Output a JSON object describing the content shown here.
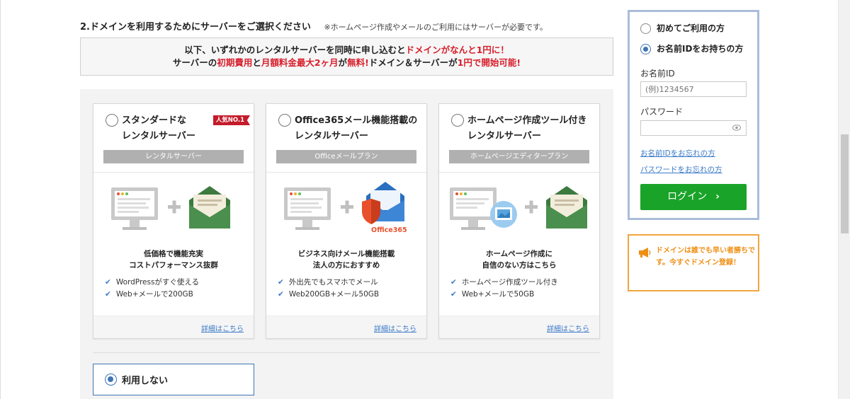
{
  "section": {
    "heading": "2.ドメインを利用するためにサーバーをご選択ください",
    "note": "※ホームページ作成やメールのご利用にはサーバーが必要です。"
  },
  "promo": {
    "line1_a": "以下、いずれかのレンタルサーバーを同時に申し込むと",
    "line1_b": "ドメインがなんと1円に！",
    "line2_a": "サーバーの",
    "line2_b": "初期費用",
    "line2_c": "と",
    "line2_d": "月額料金最大2ヶ月",
    "line2_e": "が",
    "line2_f": "無料!",
    "line2_g": "ドメイン＆サーバーが",
    "line2_h": "1円で開始可能!"
  },
  "plans": [
    {
      "title_1": "スタンダードな",
      "title_2": "レンタルサーバー",
      "badge": "人気NO.1",
      "label": "レンタルサーバー",
      "desc_1": "低価格で機能充実",
      "desc_2": "コストパフォーマンス抜群",
      "features": [
        "WordPressがすぐ使える",
        "Web+メールで200GB"
      ],
      "link": "詳細はこちら"
    },
    {
      "title_1": "Office365メール機能搭載の",
      "title_2": "レンタルサーバー",
      "label": "Officeメールプラン",
      "illus_text": "Office365",
      "desc_1": "ビジネス向けメール機能搭載",
      "desc_2": "法人の方におすすめ",
      "features": [
        "外出先でもスマホでメール",
        "Web200GB+メール50GB"
      ],
      "link": "詳細はこちら"
    },
    {
      "title_1": "ホームページ作成ツール付き",
      "title_2": "レンタルサーバー",
      "label": "ホームページエディタープラン",
      "desc_1": "ホームページ作成に",
      "desc_2": "自信のない方はこちら",
      "features": [
        "ホームページ作成ツール付き",
        "Web+メールで50GB"
      ],
      "link": "詳細はこちら"
    }
  ],
  "no_use": {
    "label": "利用しない",
    "selected": true
  },
  "login": {
    "option_first": "初めてご利用の方",
    "option_member": "お名前IDをお持ちの方",
    "selected_option": "option_member",
    "id_label": "お名前ID",
    "id_placeholder": "(例)1234567",
    "id_value": "",
    "password_label": "パスワード",
    "password_value": "",
    "forgot_id": "お名前IDをお忘れの方",
    "forgot_password": "パスワードをお忘れの方",
    "button": "ログイン",
    "button_color": "#1aa329"
  },
  "notice": {
    "icon": "megaphone-icon",
    "text": "ドメインは誰でも早い者勝ちです。今すぐドメイン登録！"
  },
  "colors": {
    "accent_blue": "#3f74b4",
    "promo_red": "#d81e2b",
    "notice_orange": "#ee8f14"
  }
}
